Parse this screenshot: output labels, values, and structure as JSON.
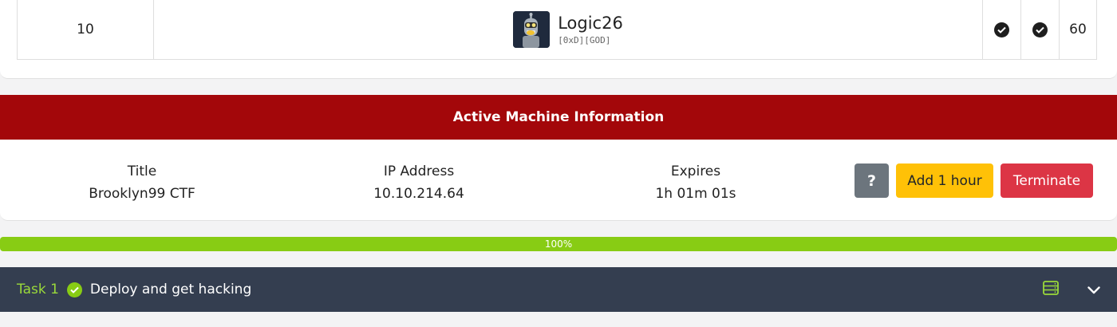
{
  "leaderboard_row": {
    "rank": "10",
    "username": "Logic26",
    "tag": "[0xD][GOD]",
    "score": "60",
    "avatar_icon": "bender-robot-avatar",
    "check_icons": [
      "check-circle-icon",
      "check-circle-icon"
    ]
  },
  "active_machine": {
    "header": "Active Machine Information",
    "title_label": "Title",
    "title_value": "Brooklyn99 CTF",
    "ip_label": "IP Address",
    "ip_value": "10.10.214.64",
    "expires_label": "Expires",
    "expires_value": "1h 01m 01s",
    "help_label": "?",
    "add_hour_label": "Add 1 hour",
    "terminate_label": "Terminate"
  },
  "progress": {
    "percent": 100,
    "label": "100%"
  },
  "task": {
    "number_label": "Task 1",
    "title": "Deploy and get hacking",
    "completed": true,
    "icons": [
      "server-icon",
      "chevron-down-icon"
    ]
  },
  "colors": {
    "header_red": "#a3070a",
    "progress_green": "#88cc14",
    "task_bar_bg": "#343e50",
    "add_button_yellow": "#ffc107",
    "terminate_red": "#dc3545",
    "help_gray": "#6c757d"
  }
}
